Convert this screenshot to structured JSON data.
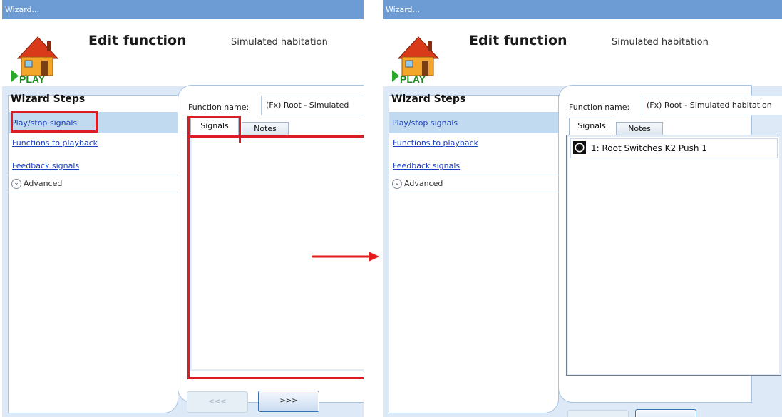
{
  "window_title": "Wizard...",
  "header": {
    "title": "Edit function",
    "subtitle": "Simulated habitation",
    "logo_text": "PLAY"
  },
  "wizard": {
    "title": "Wizard Steps",
    "steps": [
      {
        "label": "Play/stop signals"
      },
      {
        "label": "Functions to playback"
      },
      {
        "label": "Feedback signals"
      }
    ],
    "advanced_label": "Advanced"
  },
  "function_name": {
    "label": "Function name:",
    "value_left": "(Fx) Root - Simulated",
    "value_right": "(Fx) Root - Simulated habitation"
  },
  "tabs": [
    "Signals",
    "Notes"
  ],
  "signals_after": [
    {
      "label": "1: Root Switches K2 Push 1"
    }
  ],
  "buttons": {
    "back": "<<<",
    "next": ">>>"
  },
  "colors": {
    "title_bar": "#6d9bd3",
    "highlight": "#dc1c24",
    "selected_step": "#c2daf0",
    "link": "#1a3fbf"
  }
}
